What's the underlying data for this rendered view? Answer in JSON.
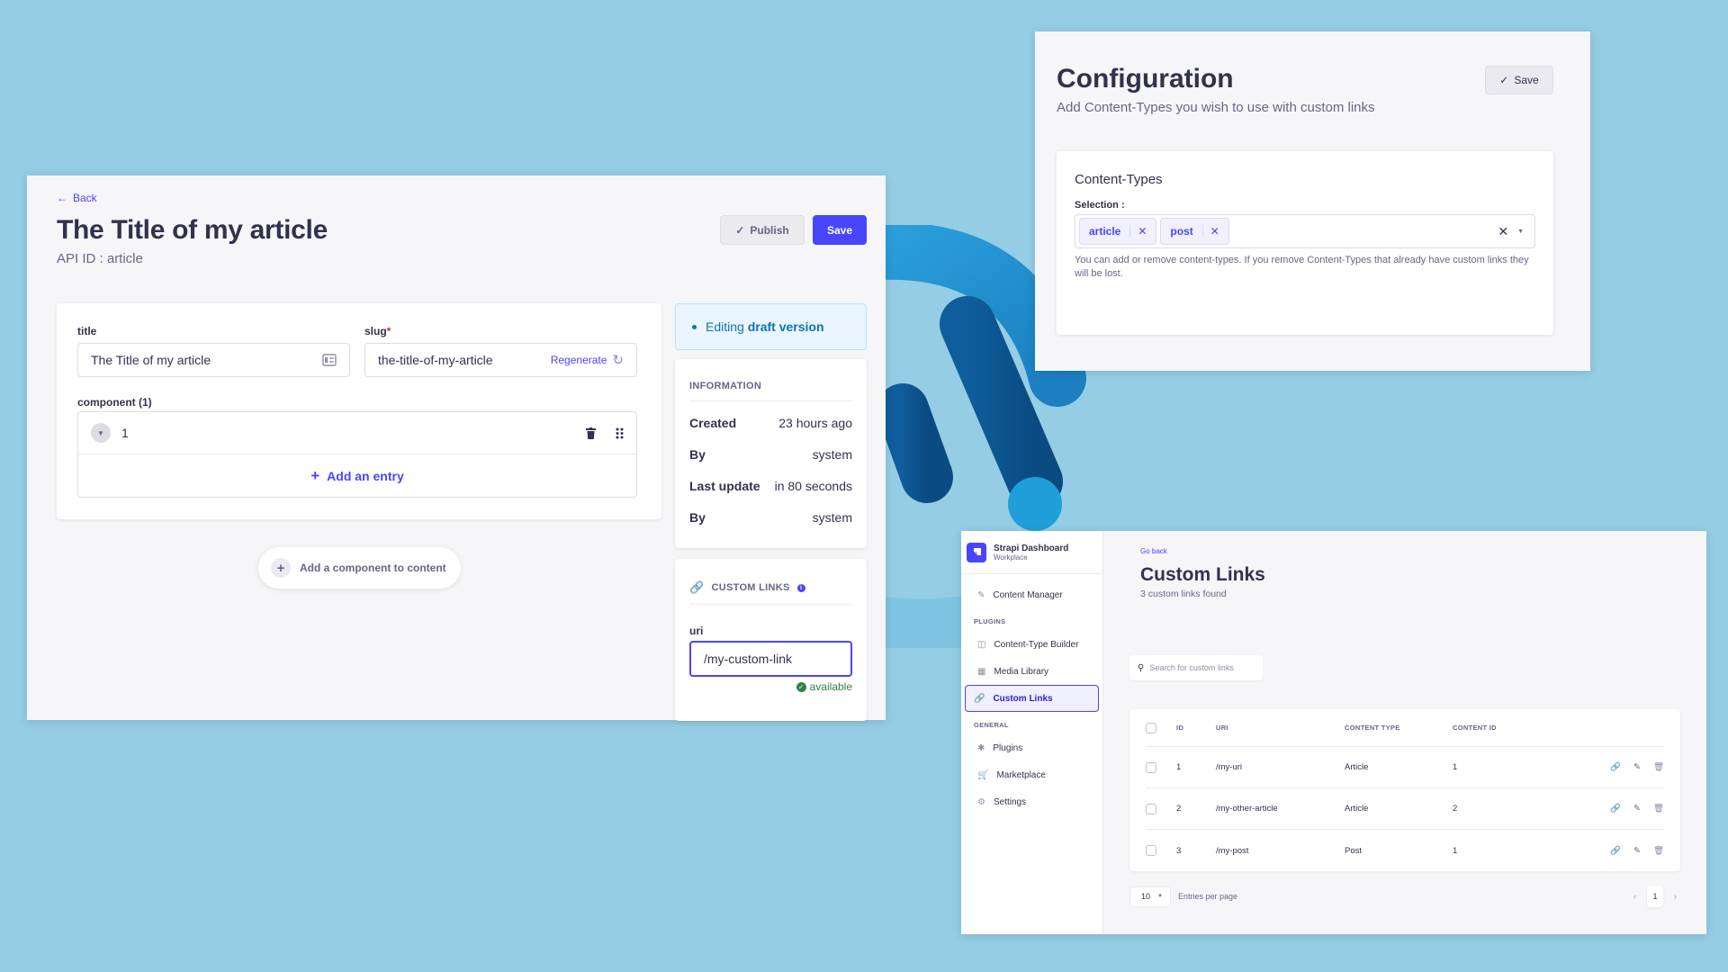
{
  "background_color": "#94cde4",
  "accent_color": "#4945ff",
  "editor": {
    "back_label": "Back",
    "title": "The Title of my article",
    "api_id": "API ID : article",
    "publish_label": "Publish",
    "save_label": "Save",
    "fields": {
      "title_label": "title",
      "title_value": "The Title of my article",
      "slug_label": "slug",
      "slug_required_mark": "*",
      "slug_value": "the-title-of-my-article",
      "regenerate_label": "Regenerate",
      "component_label": "component (1)",
      "component_entry": "1",
      "add_entry_label": "Add an entry"
    },
    "add_component_label": "Add a component to content",
    "draft": {
      "prefix": "Editing",
      "emphasis": "draft version"
    },
    "information": {
      "heading": "INFORMATION",
      "rows": [
        {
          "key": "Created",
          "value": "23 hours ago"
        },
        {
          "key": "By",
          "value": "system"
        },
        {
          "key": "Last update",
          "value": "in 80 seconds"
        },
        {
          "key": "By",
          "value": "system"
        }
      ]
    },
    "custom_links": {
      "heading": "CUSTOM LINKS",
      "uri_label": "uri",
      "uri_value": "/my-custom-link",
      "status": "available"
    }
  },
  "config": {
    "title": "Configuration",
    "subtitle": "Add Content-Types you wish to use with custom links",
    "save_label": "Save",
    "section_title": "Content-Types",
    "selection_label": "Selection :",
    "selected": [
      "article",
      "post"
    ],
    "hint": "You can add or remove content-types. If you remove Content-Types that already have custom links they will be lost."
  },
  "dashboard": {
    "brand_name": "Strapi Dashboard",
    "brand_sub": "Workplace",
    "nav": {
      "content_manager": "Content Manager",
      "plugins_heading": "PLUGINS",
      "plugins_items": [
        "Content-Type Builder",
        "Media Library",
        "Custom Links"
      ],
      "general_heading": "GENERAL",
      "general_items": [
        "Plugins",
        "Marketplace",
        "Settings"
      ]
    },
    "go_back": "Go back",
    "title": "Custom Links",
    "subtitle": "3 custom links found",
    "search_placeholder": "Search for custom links",
    "table": {
      "headers": [
        "ID",
        "URI",
        "CONTENT TYPE",
        "CONTENT ID"
      ],
      "rows": [
        {
          "id": "1",
          "uri": "/my-uri",
          "type": "Article",
          "content_id": "1"
        },
        {
          "id": "2",
          "uri": "/my-other-article",
          "type": "Article",
          "content_id": "2"
        },
        {
          "id": "3",
          "uri": "/my-post",
          "type": "Post",
          "content_id": "1"
        }
      ]
    },
    "per_page_value": "10",
    "per_page_label": "Entries per page",
    "current_page": "1"
  }
}
